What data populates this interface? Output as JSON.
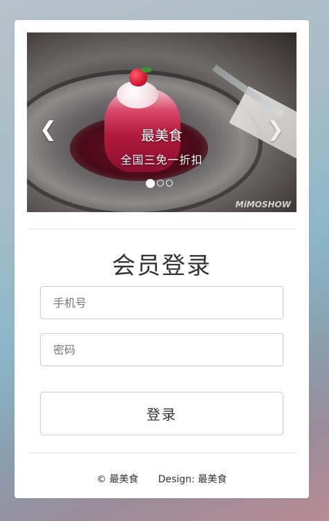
{
  "carousel": {
    "caption_title": "最美食",
    "caption_subtitle": "全国三免一折扣",
    "watermark": "MiMOSHOW",
    "prev_icon": "chevron-left-icon",
    "next_icon": "chevron-right-icon",
    "slide_count": 3,
    "active_slide": 1
  },
  "login": {
    "title": "会员登录",
    "phone_placeholder": "手机号",
    "password_placeholder": "密码",
    "submit_label": "登录"
  },
  "footer": {
    "copyright": "© 最美食",
    "design": "Design: 最美食"
  }
}
